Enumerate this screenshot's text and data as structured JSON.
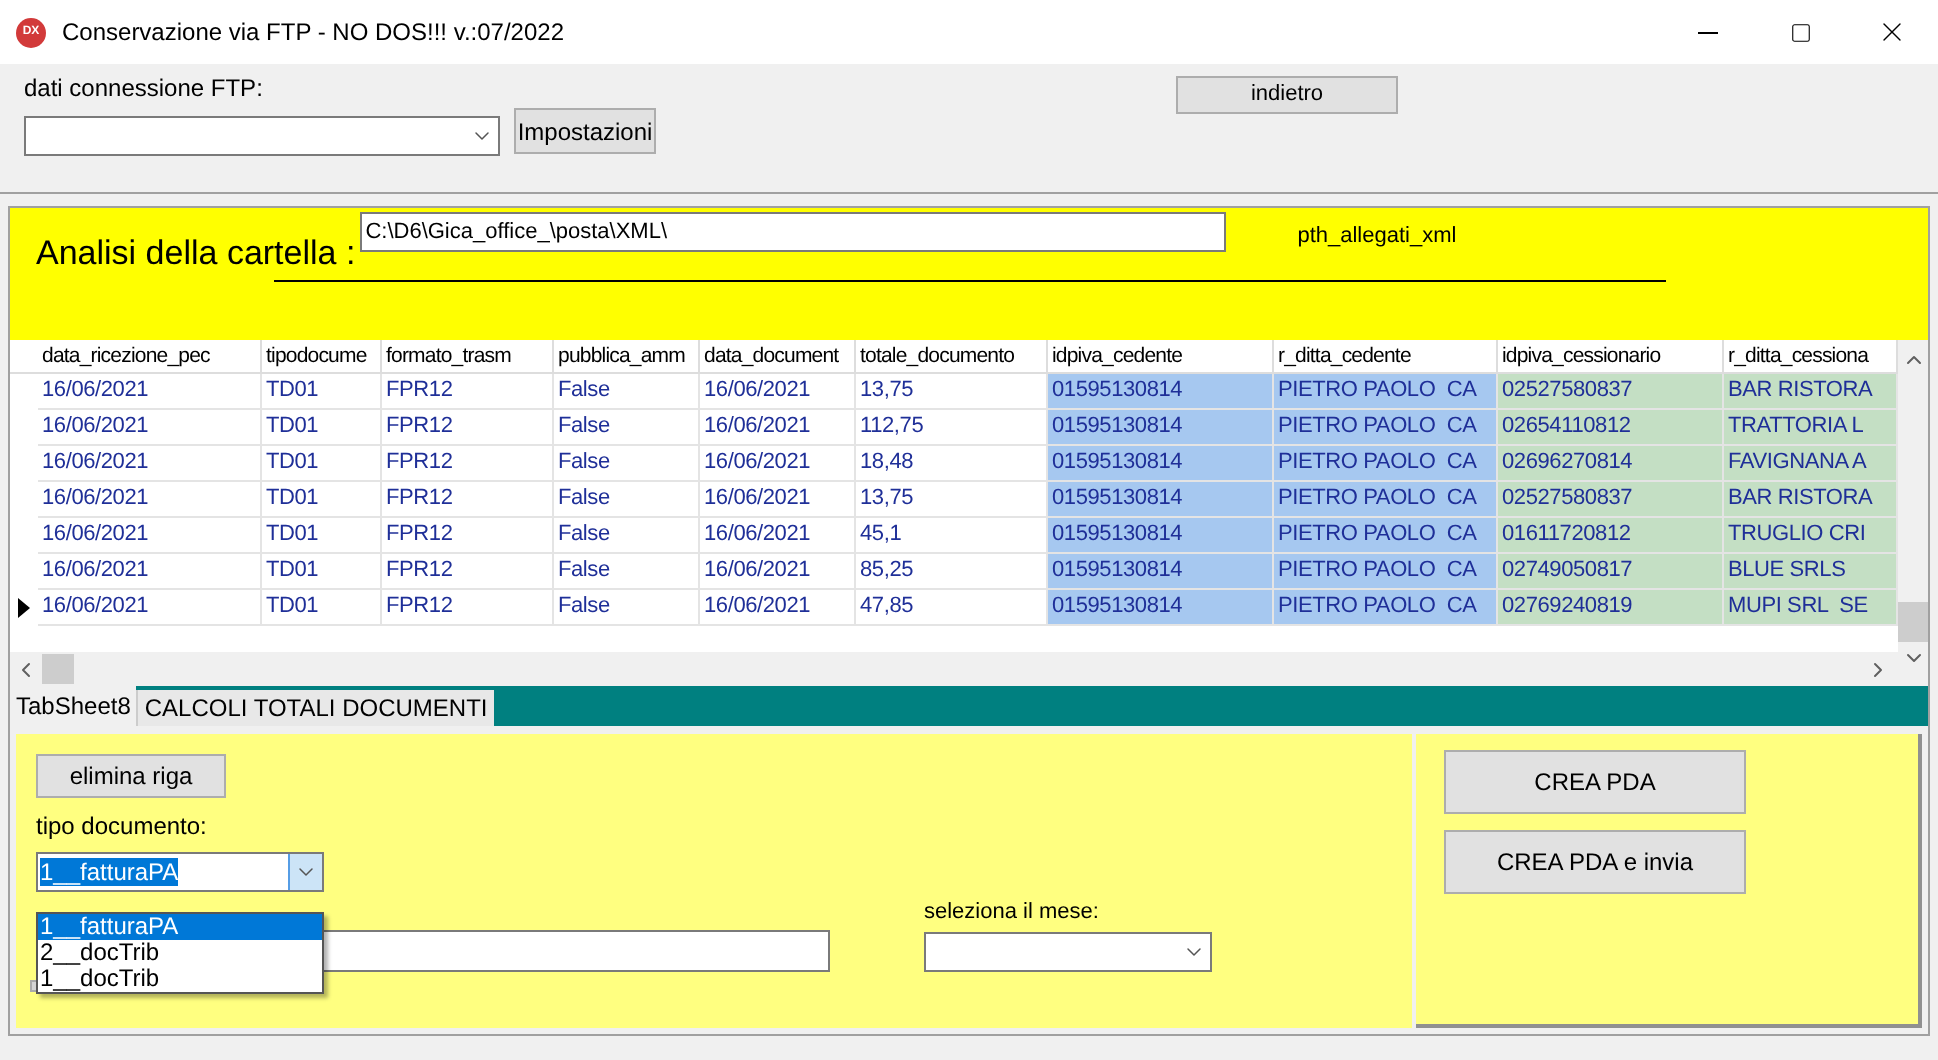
{
  "window": {
    "title": "Conservazione via FTP - NO DOS!!! v.:07/2022",
    "app_icon": "DX"
  },
  "connection": {
    "label": "dati connessione FTP:",
    "settings_button": "Impostazioni",
    "back_button": "indietro"
  },
  "folder": {
    "label": "Analisi della cartella :",
    "path": "C:\\D6\\Gica_office_\\posta\\XML\\",
    "tag": "pth_allegati_xml"
  },
  "table": {
    "columns": [
      {
        "label": "data_ricezione_pec",
        "color": "#ffffff"
      },
      {
        "label": "tipodocume",
        "color": "#ffffff"
      },
      {
        "label": "formato_trasm",
        "color": "#ffffff"
      },
      {
        "label": "pubblica_amm",
        "color": "#ffffff"
      },
      {
        "label": "data_document",
        "color": "#ffffff"
      },
      {
        "label": "totale_documento",
        "color": "#ffffff"
      },
      {
        "label": "idpiva_cedente",
        "color": "#a6c8f0"
      },
      {
        "label": "r_ditta_cedente",
        "color": "#a6c8f0"
      },
      {
        "label": "idpiva_cessionario",
        "color": "#c4dfc4"
      },
      {
        "label": "r_ditta_cessiona",
        "color": "#c4dfc4"
      }
    ],
    "rows": [
      {
        "selected": false,
        "cells": [
          "16/06/2021",
          "TD01",
          "FPR12",
          "False",
          "16/06/2021",
          "13,75",
          "01595130814",
          "PIETRO PAOLO  CA",
          "02527580837",
          "BAR RISTORA"
        ]
      },
      {
        "selected": false,
        "cells": [
          "16/06/2021",
          "TD01",
          "FPR12",
          "False",
          "16/06/2021",
          "112,75",
          "01595130814",
          "PIETRO PAOLO  CA",
          "02654110812",
          "TRATTORIA L"
        ]
      },
      {
        "selected": false,
        "cells": [
          "16/06/2021",
          "TD01",
          "FPR12",
          "False",
          "16/06/2021",
          "18,48",
          "01595130814",
          "PIETRO PAOLO  CA",
          "02696270814",
          "FAVIGNANA A"
        ]
      },
      {
        "selected": false,
        "cells": [
          "16/06/2021",
          "TD01",
          "FPR12",
          "False",
          "16/06/2021",
          "13,75",
          "01595130814",
          "PIETRO PAOLO  CA",
          "02527580837",
          "BAR RISTORA"
        ]
      },
      {
        "selected": false,
        "cells": [
          "16/06/2021",
          "TD01",
          "FPR12",
          "False",
          "16/06/2021",
          "45,1",
          "01595130814",
          "PIETRO PAOLO  CA",
          "01611720812",
          "TRUGLIO CRI"
        ]
      },
      {
        "selected": false,
        "cells": [
          "16/06/2021",
          "TD01",
          "FPR12",
          "False",
          "16/06/2021",
          "85,25",
          "01595130814",
          "PIETRO PAOLO  CA",
          "02749050817",
          "BLUE SRLS"
        ]
      },
      {
        "selected": true,
        "cells": [
          "16/06/2021",
          "TD01",
          "FPR12",
          "False",
          "16/06/2021",
          "47,85",
          "01595130814",
          "PIETRO PAOLO  CA",
          "02769240819",
          "MUPI SRL  SE"
        ]
      }
    ]
  },
  "tabs": [
    {
      "label": "TabSheet8",
      "selected": true
    },
    {
      "label": "CALCOLI TOTALI DOCUMENTI",
      "selected": false
    }
  ],
  "form": {
    "delete_button": "elimina riga",
    "doc_type_label": "tipo documento:",
    "doc_type_value": "1__fatturaPA",
    "doc_type_options": [
      {
        "label": "1__fatturaPA",
        "selected": true
      },
      {
        "label": "2__docTrib",
        "selected": false
      },
      {
        "label": "1__docTrib",
        "selected": false
      }
    ],
    "month_label": "seleziona il mese:"
  },
  "actions": [
    "CREA PDA",
    "CREA PDA e invia"
  ]
}
